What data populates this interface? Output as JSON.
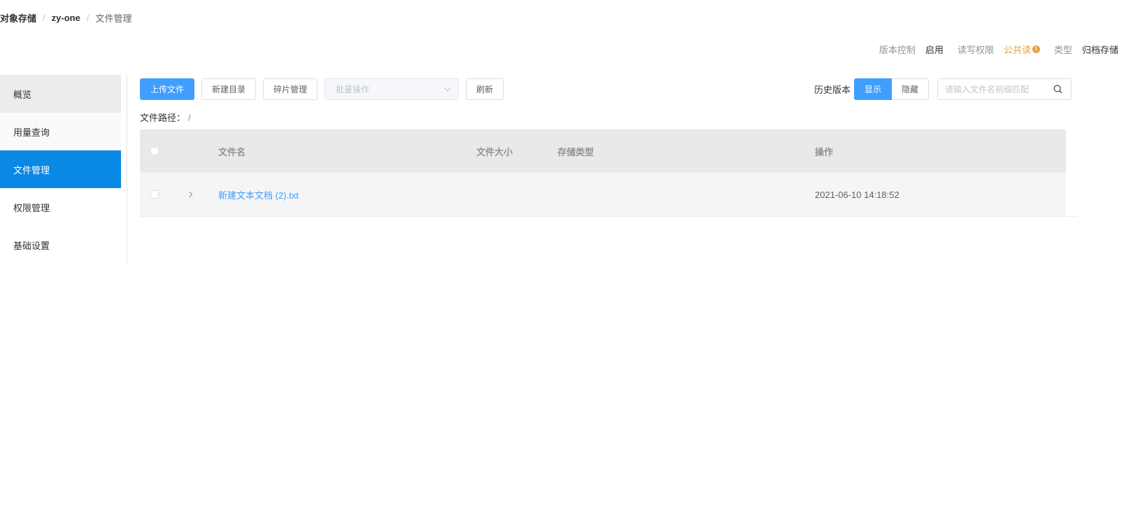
{
  "breadcrumb": {
    "item1": "对象存储",
    "item2": "zy-one",
    "item3": "文件管理"
  },
  "info": {
    "version_label": "版本控制",
    "version_value": "启用",
    "rw_label": "读写权限",
    "rw_value": "公共读",
    "rw_badge": "!",
    "type_label": "类型",
    "type_value": "归档存储"
  },
  "sidebar": {
    "items": [
      {
        "label": "概览"
      },
      {
        "label": "用量查询"
      },
      {
        "label": "文件管理"
      },
      {
        "label": "权限管理"
      },
      {
        "label": "基础设置"
      }
    ],
    "active_index": 2
  },
  "toolbar": {
    "upload": "上传文件",
    "new_dir": "新建目录",
    "fragments": "碎片管理",
    "batch_placeholder": "批量操作",
    "refresh": "刷新"
  },
  "history": {
    "label": "历史版本",
    "show": "显示",
    "hide": "隐藏",
    "selected": "显示"
  },
  "search": {
    "placeholder": "请输入文件名前缀匹配",
    "value": ""
  },
  "path": {
    "label": "文件路径：",
    "value": "/"
  },
  "table": {
    "headers": {
      "name": "文件名",
      "size": "文件大小",
      "storage": "存储类型",
      "action": "操作"
    },
    "rows": [
      {
        "name": "新建文本文档 (2).txt",
        "size": "",
        "storage": "",
        "time": "2021-06-10 14:18:52"
      }
    ]
  },
  "colors": {
    "primary": "#409eff",
    "active_nav": "#0a88e6",
    "warning": "#e6a23c"
  }
}
